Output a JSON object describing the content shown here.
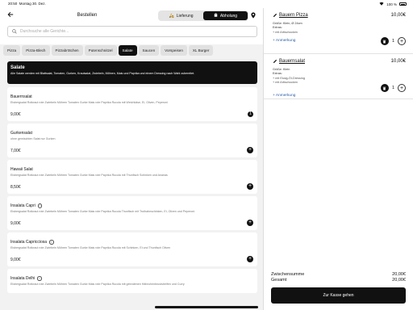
{
  "status": {
    "time": "20:50",
    "date": "Montag 30. Dez.",
    "battery": "100 %"
  },
  "header": {
    "title": "Bestellen",
    "modes": [
      {
        "label": "Lieferung",
        "active": false
      },
      {
        "label": "Abholung",
        "active": true
      }
    ]
  },
  "search": {
    "placeholder": "Durchsuche alle Gerichte..."
  },
  "categories": [
    {
      "label": "Pizza",
      "active": false
    },
    {
      "label": "Pizza-Blech",
      "active": false
    },
    {
      "label": "Pizzabrötchen",
      "active": false
    },
    {
      "label": "Putenschnitzel",
      "active": false
    },
    {
      "label": "Salate",
      "active": true
    },
    {
      "label": "Saucen",
      "active": false
    },
    {
      "label": "Vorspeisen",
      "active": false
    },
    {
      "label": "XL Burger",
      "active": false
    }
  ],
  "banner": {
    "title": "Salate",
    "description": "Alle Salate werden mit Blattsalat, Tomaten, Gurken, Krautsalat, Zwiebeln, Möhren, Mais und Paprika und einem Dressing nach Wahl zubereitet."
  },
  "items": [
    {
      "name": "Bauernsalat",
      "desc": "Eisbergsalat Rotkraut rote Zwiebeln Möhren Tomaten Gurke Mais rote Paprika Rucola mit Weichkäse, Ei, Oliven, Peperoni",
      "price": "9,00€"
    },
    {
      "name": "Gurkensalat",
      "desc": "ohne gemischten Salat nur Gurken",
      "price": "7,00€"
    },
    {
      "name": "Hawaii Salat",
      "desc": "Eisbergsalat Rotkraut rote Zwiebeln Möhren Tomaten Gurke Mais rote Paprika Rucola mit Thunfisch Schinken und Ananas",
      "price": "8,50€"
    },
    {
      "name": "Insalata Capri",
      "desc": "Eisbergsalat Rotkraut rote Zwiebeln Möhren Tomaten Gurke Mais rote Paprika Rucola Thunfisch mit Truthahnschinken, Ei, Oliven und Peperoni",
      "price": "9,00€"
    },
    {
      "name": "Insalata Capricciosa",
      "desc": "Eisbergsalat Rotkraut rote Zwiebeln Möhren Tomaten Gurke Mais rote Paprika Rucola mit Schinken, Ei und Thunfisch Oliven",
      "price": "9,00€"
    },
    {
      "name": "Insalata Delhi",
      "desc": "Eisbergsalat Rotkraut rote Zwiebeln Möhren Tomaten Gurke Mais rote Paprika Rucola mit gebratenen Hähnchenbruststreifen und Curry",
      "price": ""
    }
  ],
  "cart": {
    "items": [
      {
        "name": "Bauern Pizza",
        "price": "10,00€",
        "size": "Größe: Klein, Ø 24cm",
        "extras_label": "Extras:",
        "extras": "+ mit Artischocken",
        "note_label": "+ Anmerkung",
        "qty": "1"
      },
      {
        "name": "Bauernsalat",
        "price": "10,00€",
        "size": "Größe: Klein",
        "extras_label": "Extras:",
        "extras": "+ mit Essig-Öl-Dressing",
        "extras2": "+ mit Artischocken",
        "note_label": "+ Anmerkung",
        "qty": "1"
      }
    ],
    "subtotal_label": "Zwischensumme",
    "subtotal": "20,00€",
    "total_label": "Gesamt",
    "total": "20,00€",
    "checkout_label": "Zur Kasse gehen"
  }
}
